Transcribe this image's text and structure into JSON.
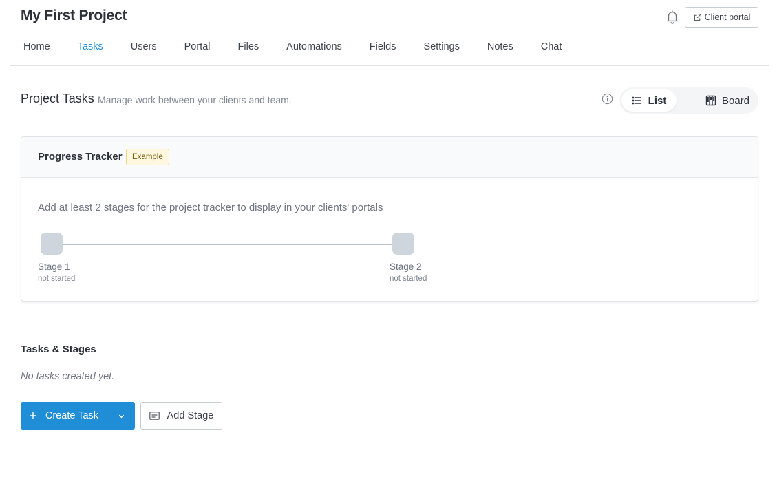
{
  "header": {
    "project_title": "My First Project",
    "client_portal_label": "Client portal",
    "icons": {
      "notifications": "bell-icon",
      "external": "external-link-icon"
    }
  },
  "tabs": [
    {
      "label": "Home",
      "active": false
    },
    {
      "label": "Tasks",
      "active": true
    },
    {
      "label": "Users",
      "active": false
    },
    {
      "label": "Portal",
      "active": false
    },
    {
      "label": "Files",
      "active": false
    },
    {
      "label": "Automations",
      "active": false
    },
    {
      "label": "Fields",
      "active": false
    },
    {
      "label": "Settings",
      "active": false
    },
    {
      "label": "Notes",
      "active": false
    },
    {
      "label": "Chat",
      "active": false
    }
  ],
  "section": {
    "title": "Project Tasks",
    "subtitle": "Manage work between your clients and team.",
    "view_toggle": {
      "list_label": "List",
      "board_label": "Board",
      "selected": "List"
    }
  },
  "tracker": {
    "title": "Progress Tracker",
    "badge": "Example",
    "message": "Add at least 2 stages for the project tracker to display in your clients' portals",
    "stages": [
      {
        "name": "Stage 1",
        "status": "not started"
      },
      {
        "name": "Stage 2",
        "status": "not started"
      }
    ]
  },
  "tasks": {
    "title": "Tasks & Stages",
    "empty_message": "No tasks created yet.",
    "create_label": "Create Task",
    "add_stage_label": "Add Stage"
  },
  "colors": {
    "accent": "#1f8ed6",
    "badge_bg": "#fff8de",
    "badge_border": "#f0d58a"
  }
}
